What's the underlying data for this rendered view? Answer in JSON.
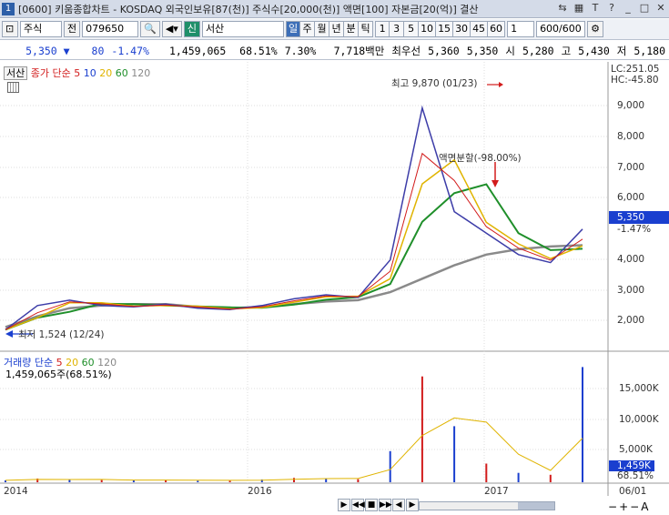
{
  "titlebar": {
    "index": "1",
    "title": "[0600] 키움종합차트 - KOSDAQ 외국인보유[87(천)] 주식수[20,000(천)] 액면[100] 자본금[20(억)] 결산"
  },
  "toolbar": {
    "market": "주식",
    "search_prefix": "전",
    "code": "079650",
    "badge": "신",
    "name": "서산",
    "periods": [
      "일",
      "주",
      "월",
      "년",
      "분",
      "틱"
    ],
    "active_period": "일",
    "minutes": [
      "1",
      "3",
      "5",
      "10",
      "15",
      "30",
      "45",
      "60"
    ],
    "count_a": "1",
    "count_b": "600/600"
  },
  "quote": {
    "price": "5,350",
    "dir": "▼",
    "change": "80",
    "rate": "-1.47%",
    "volume": "1,459,065",
    "vol_rate": "68.51%",
    "turnover": "7.30%",
    "amount": "7,718백만",
    "pref_label": "최우선",
    "pref_ask": "5,360",
    "pref_bid": "5,350",
    "open_label": "시",
    "open": "5,280",
    "high_label": "고",
    "high": "5,430",
    "low_label": "저",
    "low": "5,180"
  },
  "price_panel": {
    "name": "서산",
    "legend_label": "종가 단순",
    "ma": [
      "5",
      "10",
      "20",
      "60",
      "120"
    ],
    "ma_colors": [
      "#d21c1c",
      "#1a3fcf",
      "#e0b400",
      "#1f8f2a",
      "#888888"
    ],
    "lc": "LC:251.05",
    "hc": "HC:-45.80",
    "high_note": "최고 9,870 (01/23)",
    "low_note": "최저 1,524 (12/24)",
    "split_note": "액면분할(-98.00%)",
    "cur_price": "5,350",
    "cur_rate": "-1.47%",
    "y_ticks": [
      "9,000",
      "8,000",
      "7,000",
      "6,000",
      "4,000",
      "3,000",
      "2,000"
    ]
  },
  "volume_panel": {
    "legend_label": "거래량 단순",
    "ma": [
      "5",
      "20",
      "60",
      "120"
    ],
    "volume_text": "1,459,065주(68.51%)",
    "y_ticks": [
      "15,000K",
      "10,000K",
      "5,000K"
    ],
    "cur_vol": "1,459K",
    "cur_rate": "68.51%"
  },
  "x_labels": [
    "2014",
    "2016",
    "2017",
    "06/01"
  ],
  "chart_data": {
    "type": "line",
    "x": [
      "2014-01",
      "2014-04",
      "2014-07",
      "2014-10",
      "2015-01",
      "2015-04",
      "2015-07",
      "2015-10",
      "2016-01",
      "2016-04",
      "2016-07",
      "2016-10",
      "2016-12",
      "2017-01",
      "2017-02",
      "2017-03",
      "2017-04",
      "2017-05",
      "2017-06"
    ],
    "series": [
      {
        "name": "종가",
        "values": [
          1600,
          2500,
          2700,
          2500,
          2450,
          2550,
          2400,
          2350,
          2500,
          2750,
          2900,
          2800,
          4200,
          9870,
          6000,
          5200,
          4400,
          4100,
          5350
        ]
      },
      {
        "name": "120",
        "values": [
          1700,
          2100,
          2400,
          2500,
          2550,
          2550,
          2450,
          2400,
          2450,
          2550,
          2650,
          2700,
          3000,
          3500,
          4000,
          4400,
          4600,
          4700,
          4750
        ]
      }
    ],
    "ylim": [
      1000,
      10500
    ]
  }
}
